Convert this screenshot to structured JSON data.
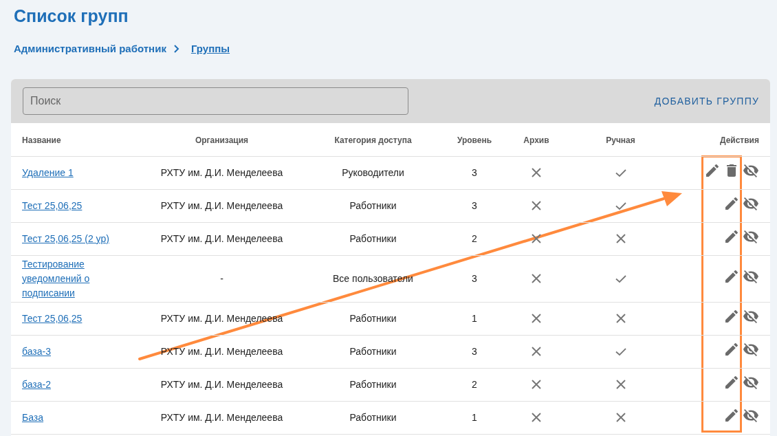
{
  "page_title": "Список групп",
  "breadcrumbs": [
    {
      "label": "Административный работник",
      "current": false
    },
    {
      "label": "Группы",
      "current": true
    }
  ],
  "search": {
    "placeholder": "Поиск"
  },
  "add_button": "ДОБАВИТЬ ГРУППУ",
  "table": {
    "columns": [
      "Название",
      "Организация",
      "Категория доступа",
      "Уровень",
      "Архив",
      "Ручная",
      "Действия"
    ],
    "rows": [
      {
        "name": "Удаление 1",
        "organization": "РХТУ им. Д.И. Менделеева",
        "category": "Руководители",
        "level_value": "3",
        "archived": false,
        "manual": true,
        "deletable": true
      },
      {
        "name": "Тест 25,06,25",
        "organization": "РХТУ им. Д.И. Менделеева",
        "category": "Работники",
        "level_value": "3",
        "archived": false,
        "manual": true,
        "deletable": false
      },
      {
        "name": "Тест 25,06,25 (2 ур)",
        "organization": "РХТУ им. Д.И. Менделеева",
        "category": "Работники",
        "level_value": "2",
        "archived": false,
        "manual": false,
        "deletable": false
      },
      {
        "name": "Тестирование уведомлений о подписании",
        "organization": "-",
        "category": "Все пользователи",
        "level_value": "3",
        "archived": false,
        "manual": true,
        "deletable": false
      },
      {
        "name": "Тест 25,06,25",
        "organization": "РХТУ им. Д.И. Менделеева",
        "category": "Работники",
        "level_value": "1",
        "archived": false,
        "manual": false,
        "deletable": false
      },
      {
        "name": "база-3",
        "organization": "РХТУ им. Д.И. Менделеева",
        "category": "Работники",
        "level_value": "3",
        "archived": false,
        "manual": true,
        "deletable": false
      },
      {
        "name": "база-2",
        "organization": "РХТУ им. Д.И. Менделеева",
        "category": "Работники",
        "level_value": "2",
        "archived": false,
        "manual": false,
        "deletable": false
      },
      {
        "name": "База",
        "organization": "РХТУ им. Д.И. Менделеева",
        "category": "Работники",
        "level_value": "1",
        "archived": false,
        "manual": false,
        "deletable": false
      }
    ]
  }
}
